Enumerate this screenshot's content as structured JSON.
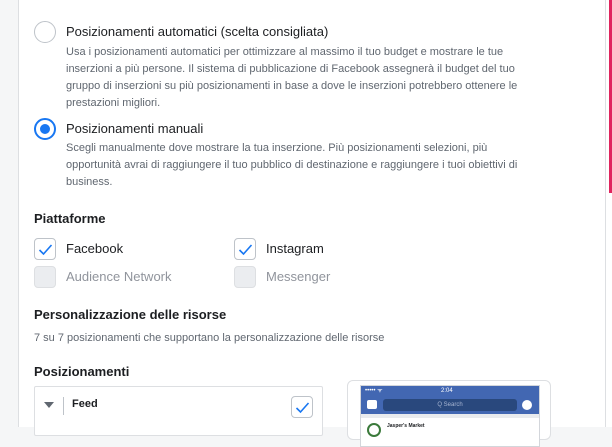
{
  "placements": {
    "automatic": {
      "title": "Posizionamenti automatici (scelta consigliata)",
      "desc_lines": [
        "Usa i posizionamenti automatici per ottimizzare al massimo il tuo budget e mostrare le tue",
        "inserzioni a più persone. Il sistema di pubblicazione di Facebook assegnerà il budget del tuo",
        "gruppo di inserzioni su più posizionamenti in base a dove le inserzioni potrebbero ottenere le",
        "prestazioni migliori."
      ],
      "selected": false
    },
    "manual": {
      "title": "Posizionamenti manuali",
      "desc_lines": [
        "Scegli manualmente dove mostrare la tua inserzione. Più posizionamenti selezioni, più",
        "opportunità avrai di raggiungere il tuo pubblico di destinazione e raggiungere i tuoi obiettivi di",
        "business."
      ],
      "selected": true
    }
  },
  "platforms": {
    "title": "Piattaforme",
    "items": [
      {
        "label": "Facebook",
        "checked": true,
        "disabled": false
      },
      {
        "label": "Instagram",
        "checked": true,
        "disabled": false
      },
      {
        "label": "Audience Network",
        "checked": false,
        "disabled": true
      },
      {
        "label": "Messenger",
        "checked": false,
        "disabled": true
      }
    ]
  },
  "customization": {
    "title": "Personalizzazione delle risorse",
    "subtitle": "7 su 7 posizionamenti che supportano la personalizzazione delle risorse"
  },
  "positions": {
    "title": "Posizionamenti",
    "feed_label": "Feed",
    "feed_checked": true
  },
  "preview": {
    "status_left": "••••• ᯤ",
    "status_time": "2:04",
    "search_placeholder": "Q Search",
    "post_name": "Jasper's Market"
  },
  "colors": {
    "accent": "#1877f2",
    "warning_bar": "#e0245e",
    "facebook_blue": "#4267b2"
  }
}
